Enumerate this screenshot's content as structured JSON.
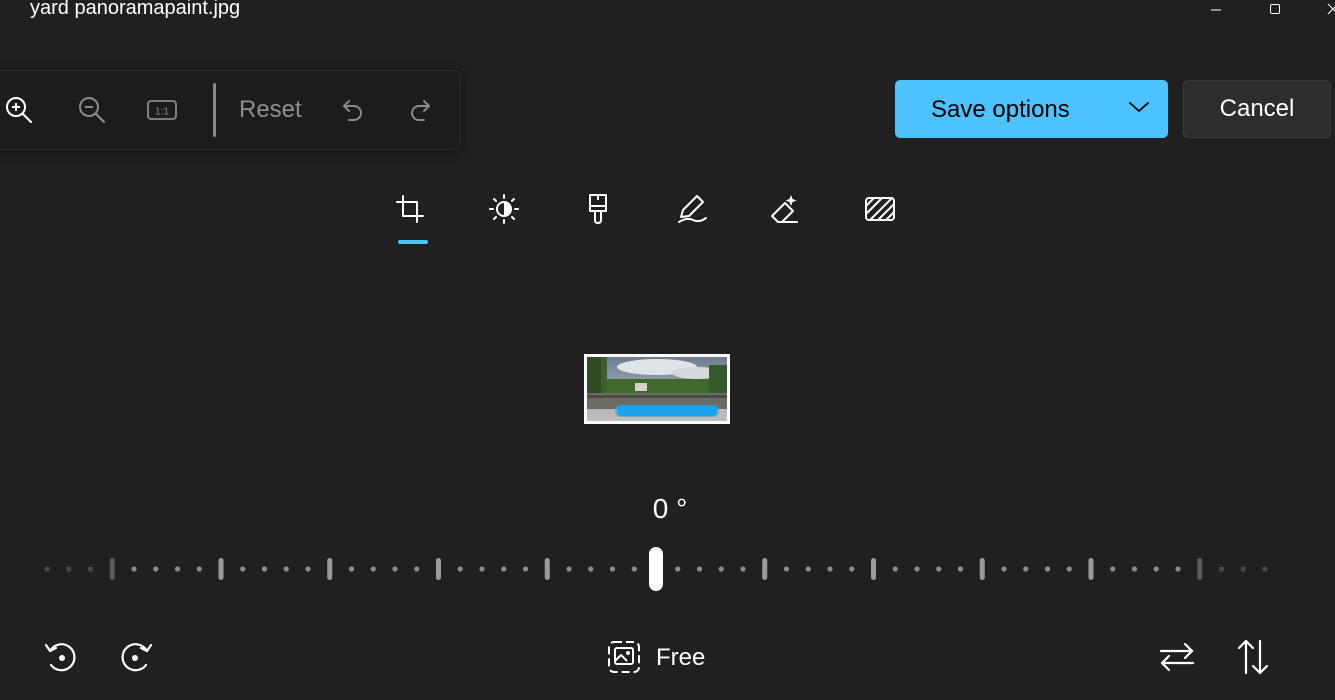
{
  "window": {
    "title": "yard panoramapaint.jpg",
    "controls": [
      "minimize-icon",
      "maximize-icon",
      "close-icon"
    ]
  },
  "zoom_toolbar": {
    "icons": [
      "zoom-in-icon",
      "zoom-out-icon",
      "actual-size-icon",
      "undo-icon",
      "redo-icon"
    ],
    "actual_size_label": "1:1",
    "reset_label": "Reset"
  },
  "actions": {
    "save_label": "Save options",
    "cancel_label": "Cancel"
  },
  "tools": {
    "items": [
      "crop-icon",
      "adjustment-icon",
      "filter-icon",
      "markup-icon",
      "erase-icon",
      "background-icon"
    ],
    "selected": "crop-icon"
  },
  "crop": {
    "angle_label": "0 °",
    "angle_value": 0,
    "aspect_label": "Free"
  },
  "colors": {
    "accent": "#4cc2ff",
    "background": "#202020"
  }
}
